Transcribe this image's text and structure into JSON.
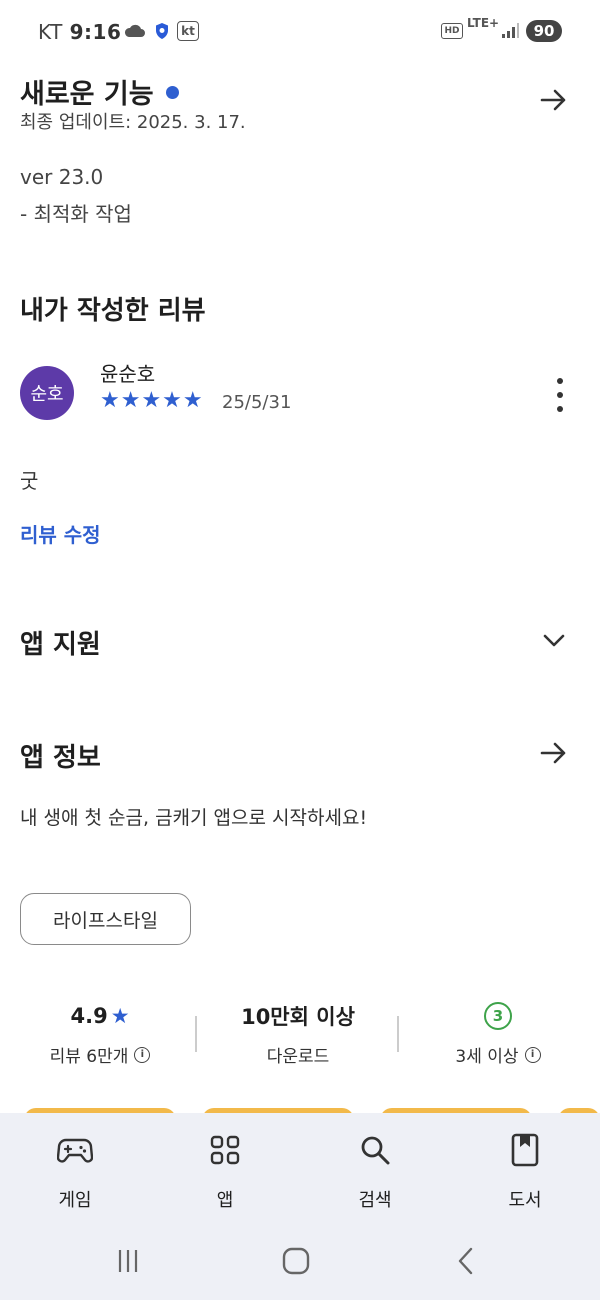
{
  "status_bar": {
    "carrier": "KT",
    "time": "9:16",
    "kt_badge": "kt",
    "hd_badge": "HD",
    "network": "LTE+",
    "battery": "90"
  },
  "whats_new": {
    "title": "새로운 기능",
    "updated": "최종 업데이트: 2025. 3. 17.",
    "version": "ver 23.0",
    "note": "- 최적화 작업"
  },
  "my_review": {
    "section_title": "내가 작성한 리뷰",
    "avatar_text": "순호",
    "reviewer": "윤순호",
    "stars": "★★★★★",
    "rating": 5,
    "date": "25/5/31",
    "text": "굿",
    "edit_link": "리뷰 수정"
  },
  "app_support": {
    "title": "앱 지원"
  },
  "app_info": {
    "title": "앱 정보",
    "description": "내 생애 첫 순금, 금캐기 앱으로 시작하세요!",
    "category_chip": "라이프스타일"
  },
  "stats": {
    "rating_value": "4.9",
    "rating_star": "★",
    "reviews_label": "리뷰 6만개",
    "downloads_value": "10만회 이상",
    "downloads_label": "다운로드",
    "age_badge": "3",
    "age_label": "3세 이상"
  },
  "bottom_nav": {
    "items": [
      {
        "label": "게임",
        "icon": "gamepad-icon"
      },
      {
        "label": "앱",
        "icon": "apps-grid-icon"
      },
      {
        "label": "검색",
        "icon": "search-icon"
      },
      {
        "label": "도서",
        "icon": "book-icon"
      }
    ]
  },
  "colors": {
    "accent": "#2f5fd0",
    "avatar": "#5d3aa8",
    "age_green": "#3ea34a",
    "nav_bg": "#eef0f6"
  }
}
